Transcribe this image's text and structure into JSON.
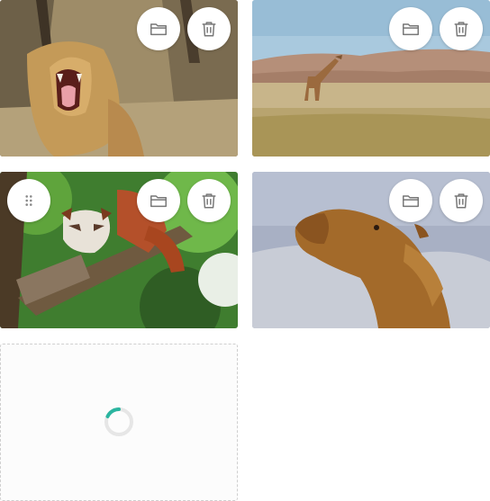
{
  "gallery": {
    "items": [
      {
        "subject": "lion",
        "actions": [
          "folder-icon",
          "trash-icon"
        ]
      },
      {
        "subject": "giraffe",
        "actions": [
          "folder-icon",
          "trash-icon"
        ]
      },
      {
        "subject": "red panda",
        "actions": [
          "drag-handle-icon",
          "folder-icon",
          "trash-icon"
        ]
      },
      {
        "subject": "camel",
        "actions": [
          "folder-icon",
          "trash-icon"
        ]
      }
    ],
    "uploading": {
      "state": "loading",
      "progress_icon": "spinner"
    }
  },
  "colors": {
    "spinner_accent": "#2bb5a0",
    "spinner_track": "#e6e6e6",
    "icon_gray": "#777777",
    "dashed_border": "#cfcfcf"
  }
}
